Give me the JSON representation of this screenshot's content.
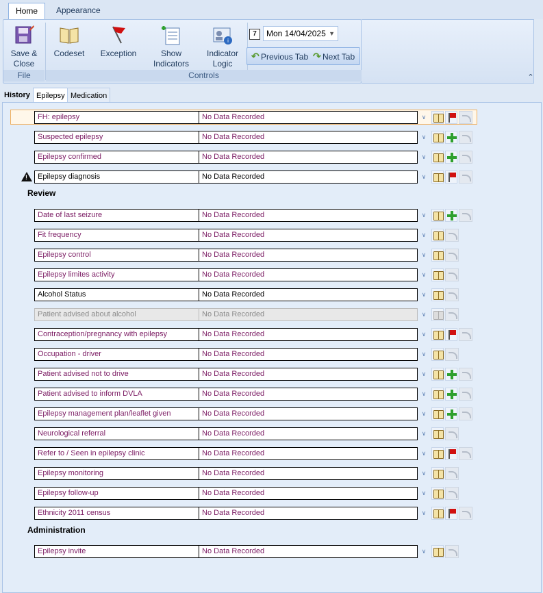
{
  "ribbon_tabs": [
    "Home",
    "Appearance"
  ],
  "ribbon": {
    "file_group": "File",
    "controls_group": "Controls",
    "save_close": "Save & Close",
    "codeset": "Codeset",
    "exception": "Exception",
    "show_indicators": "Show Indicators",
    "indicator_logic": "Indicator Logic",
    "date": "Mon 14/04/2025",
    "previous_tab": "Previous Tab",
    "next_tab": "Next Tab"
  },
  "content_tabs": [
    "History",
    "Epilepsy",
    "Medication"
  ],
  "sections": {
    "review": "Review",
    "administration": "Administration"
  },
  "rows": [
    {
      "label": "FH: epilepsy",
      "value": "No Data Recorded",
      "action": "flag"
    },
    {
      "label": "Suspected epilepsy",
      "value": "No Data Recorded",
      "action": "plus"
    },
    {
      "label": "Epilepsy confirmed",
      "value": "No Data Recorded",
      "action": "plus"
    },
    {
      "label": "Epilepsy diagnosis",
      "value": "No Data Recorded",
      "action": "flag"
    },
    {
      "label": "Date of last seizure",
      "value": "No Data Recorded",
      "action": "plus"
    },
    {
      "label": "Fit frequency",
      "value": "No Data Recorded",
      "action": "none"
    },
    {
      "label": "Epilepsy control",
      "value": "No Data Recorded",
      "action": "none"
    },
    {
      "label": "Epilepsy limites activity",
      "value": "No Data Recorded",
      "action": "none"
    },
    {
      "label": "Alcohol Status",
      "value": "No Data Recorded",
      "action": "none"
    },
    {
      "label": "Patient advised about alcohol",
      "value": "No Data Recorded",
      "action": "none"
    },
    {
      "label": "Contraception/pregnancy with epilepsy",
      "value": "No Data Recorded",
      "action": "flag"
    },
    {
      "label": "Occupation - driver",
      "value": "No Data Recorded",
      "action": "none"
    },
    {
      "label": "Patient advised not to drive",
      "value": "No Data Recorded",
      "action": "plus"
    },
    {
      "label": "Patient advised to inform DVLA",
      "value": "No Data Recorded",
      "action": "plus"
    },
    {
      "label": "Epilepsy management plan/leaflet given",
      "value": "No Data Recorded",
      "action": "plus"
    },
    {
      "label": "Neurological referral",
      "value": "No Data Recorded",
      "action": "none"
    },
    {
      "label": "Refer to / Seen in epilepsy clinic",
      "value": "No Data Recorded",
      "action": "flag"
    },
    {
      "label": "Epilepsy monitoring",
      "value": "No Data Recorded",
      "action": "none"
    },
    {
      "label": "Epilepsy follow-up",
      "value": "No Data Recorded",
      "action": "none"
    },
    {
      "label": "Ethnicity 2011 census",
      "value": "No Data Recorded",
      "action": "flag"
    },
    {
      "label": "Epilepsy invite",
      "value": "No Data Recorded",
      "action": "none"
    }
  ]
}
